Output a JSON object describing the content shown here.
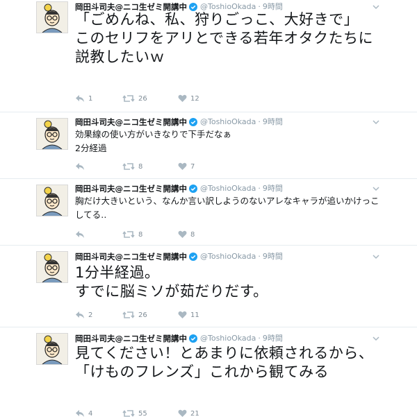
{
  "tweets": [
    {
      "name": "岡田斗司夫@ニコ生ゼミ開講中",
      "handle": "@ToshioOkada",
      "separator": "·",
      "time": "9時間",
      "text": "「ごめんね、私、狩りごっこ、大好きで」\nこのセリフをアリとできる若年オタクたちに説教したいｗ",
      "reply_count": "1",
      "retweet_count": "26",
      "like_count": "12"
    },
    {
      "name": "岡田斗司夫@ニコ生ゼミ開講中",
      "handle": "@ToshioOkada",
      "separator": "·",
      "time": "9時間",
      "text": "効果線の使い方がいきなりで下手だなぁ\n2分経過",
      "reply_count": "",
      "retweet_count": "8",
      "like_count": "7"
    },
    {
      "name": "岡田斗司夫@ニコ生ゼミ開講中",
      "handle": "@ToshioOkada",
      "separator": "·",
      "time": "9時間",
      "text": "胸だけ大きいという、なんか言い訳しようのないアレなキャラが追いかけっこしてる‥",
      "reply_count": "",
      "retweet_count": "8",
      "like_count": "8"
    },
    {
      "name": "岡田斗司夫@ニコ生ゼミ開講中",
      "handle": "@ToshioOkada",
      "separator": "·",
      "time": "9時間",
      "text": "1分半経過。\nすでに脳ミソが茹だりだす。",
      "reply_count": "2",
      "retweet_count": "26",
      "like_count": "11"
    },
    {
      "name": "岡田斗司夫@ニコ生ゼミ開講中",
      "handle": "@ToshioOkada",
      "separator": "·",
      "time": "9時間",
      "text": "見てください！とあまりに依頼されるから、「けものフレンズ」これから観てみる",
      "reply_count": "4",
      "retweet_count": "55",
      "like_count": "21"
    }
  ],
  "colors": {
    "verified": "#1da1f2",
    "icon_gray": "#aab8c2",
    "name": "#14171a",
    "meta": "#8899a6",
    "divider": "#e6ecf0"
  },
  "icons": {
    "reply": "reply-icon",
    "retweet": "retweet-icon",
    "like": "heart-icon",
    "verified": "verified-badge-icon",
    "menu": "chevron-down-icon"
  }
}
